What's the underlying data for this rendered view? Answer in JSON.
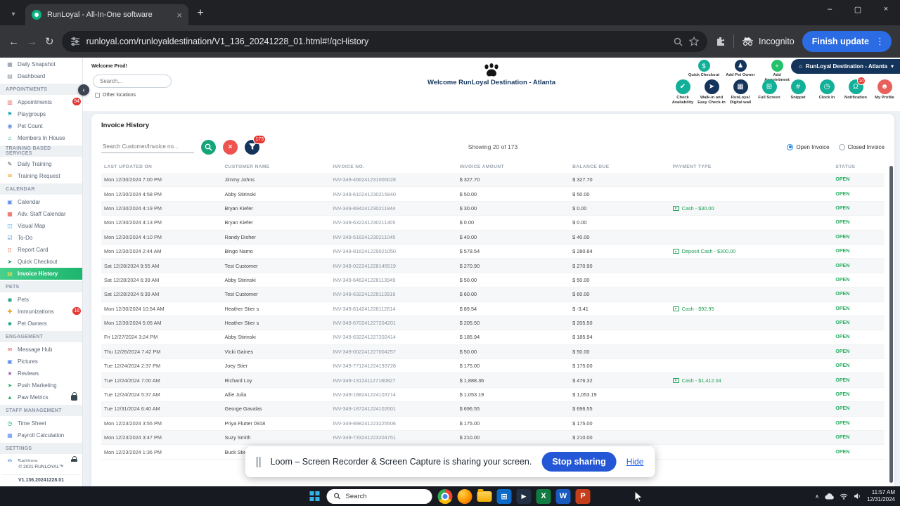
{
  "colors": {
    "teal": "#12b098",
    "navy": "#14345c",
    "badge_red": "#e53935",
    "status_green": "#27ae60",
    "link_blue": "#2563eb",
    "update_blue": "#2b6be4",
    "accent_green": "#1fb96b"
  },
  "browser": {
    "tab_title": "RunLoyal - All-In-One software",
    "url": "runloyal.com/runloyaldestination/V1_136_20241228_01.html#!/qcHistory",
    "incognito_label": "Incognito",
    "update_button": "Finish update"
  },
  "sidebar": {
    "top_items": [
      {
        "label": "Daily Snapshot",
        "icon": "snapshot-icon",
        "icon_color": "#7e8ca0"
      },
      {
        "label": "Dashboard",
        "icon": "dashboard-icon",
        "icon_color": "#8a94a6"
      }
    ],
    "sections": [
      {
        "title": "APPOINTMENTS",
        "items": [
          {
            "label": "Appointments",
            "icon": "appointments-icon",
            "icon_color": "#ef6461",
            "badge": "94"
          },
          {
            "label": "Playgroups",
            "icon": "playgroups-icon",
            "icon_color": "#17a2b8"
          },
          {
            "label": "Pet Count",
            "icon": "pet-count-icon",
            "icon_color": "#5b8def"
          },
          {
            "label": "Members In House",
            "icon": "members-icon",
            "icon_color": "#16a085"
          }
        ]
      },
      {
        "title": "TRAINING BASED SERVICES",
        "items": [
          {
            "label": "Daily Training",
            "icon": "daily-training-icon",
            "icon_color": "#444444"
          },
          {
            "label": "Training Request",
            "icon": "training-request-icon",
            "icon_color": "#f39c12"
          }
        ]
      },
      {
        "title": "CALENDAR",
        "items": [
          {
            "label": "Calendar",
            "icon": "calendar-icon",
            "icon_color": "#5b8def"
          },
          {
            "label": "Adv. Staff Calendar",
            "icon": "adv-calendar-icon",
            "icon_color": "#e74c3c"
          },
          {
            "label": "Visual Map",
            "icon": "visual-map-icon",
            "icon_color": "#48b0f7"
          },
          {
            "label": "To-Do",
            "icon": "todo-icon",
            "icon_color": "#3b7ddd"
          },
          {
            "label": "Report Card",
            "icon": "report-card-icon",
            "icon_color": "#e74c3c"
          },
          {
            "label": "Quick Checkout",
            "icon": "quick-checkout-icon",
            "icon_color": "#16a085"
          },
          {
            "label": "Invoice History",
            "icon": "invoice-history-icon",
            "icon_color": "#ffd54a",
            "active": true
          }
        ]
      },
      {
        "title": "PETS",
        "items": [
          {
            "label": "Pets",
            "icon": "pets-icon",
            "icon_color": "#16a085"
          },
          {
            "label": "Immunizations",
            "icon": "immunizations-icon",
            "icon_color": "#f39c12",
            "badge": "16"
          },
          {
            "label": "Pet Owners",
            "icon": "pet-owners-icon",
            "icon_color": "#16a085"
          }
        ]
      },
      {
        "title": "ENGAGEMENT",
        "items": [
          {
            "label": "Message Hub",
            "icon": "message-hub-icon",
            "icon_color": "#e8605c"
          },
          {
            "label": "Pictures",
            "icon": "pictures-icon",
            "icon_color": "#5b8def"
          },
          {
            "label": "Reviews",
            "icon": "reviews-icon",
            "icon_color": "#9b59b6"
          },
          {
            "label": "Push Marketing",
            "icon": "push-marketing-icon",
            "icon_color": "#27ae60"
          },
          {
            "label": "Paw Metrics",
            "icon": "paw-metrics-icon",
            "icon_color": "#27ae60",
            "locked": true
          }
        ]
      },
      {
        "title": "STAFF MANAGEMENT",
        "items": [
          {
            "label": "Time Sheet",
            "icon": "time-sheet-icon",
            "icon_color": "#16a085"
          },
          {
            "label": "Payroll Calculation",
            "icon": "payroll-icon",
            "icon_color": "#5b8def"
          }
        ]
      },
      {
        "title": "SETTINGS",
        "items": [
          {
            "label": "Settings",
            "icon": "settings-icon",
            "icon_color": "#3b7ddd",
            "locked": true
          }
        ]
      }
    ],
    "copyright": "© 2021  RUNLOYAL™",
    "version": "V1.136.20241228.01"
  },
  "header": {
    "welcome_label": "Welcome Prod!",
    "search_placeholder": "Search...",
    "other_locations_label": "Other locations",
    "welcome_title": "Welcome RunLoyal Destination - Atlanta",
    "location_label": "RunLoyal Destination - Atlanta",
    "quick_actions": [
      {
        "label": "Quick Checkout",
        "icon": "cart-icon",
        "color": "#12b098"
      },
      {
        "label": "Add Pet Owner",
        "icon": "person-add-icon",
        "color": "#14345c"
      },
      {
        "label": "Add Appointment",
        "icon": "calendar-add-icon",
        "color": "#23c16b"
      }
    ],
    "circle_icons": [
      {
        "label": "Check Availability",
        "icon": "availability-icon",
        "color": "#12b098"
      },
      {
        "label": "Walk-in and Easy Check-in",
        "icon": "walkin-icon",
        "color": "#14345c"
      },
      {
        "label": "RunLoyal Digital wall",
        "icon": "digital-wall-icon",
        "color": "#14345c"
      },
      {
        "label": "Full Screen",
        "icon": "fullscreen-icon",
        "color": "#12b098"
      },
      {
        "label": "Snippet",
        "icon": "snippet-icon",
        "color": "#12b098"
      },
      {
        "label": "Clock In",
        "icon": "clock-icon",
        "color": "#12b098"
      },
      {
        "label": "Notification",
        "icon": "bell-icon",
        "color": "#12b098",
        "badge": "10"
      },
      {
        "label": "My Profile",
        "icon": "profile-icon",
        "color": "#e8605c"
      }
    ]
  },
  "invoice": {
    "title": "Invoice History",
    "search_placeholder": "Search Customer/Invoice no...",
    "filter_count": "173",
    "showing": "Showing 20 of 173",
    "radio_open": "Open Invoice",
    "radio_closed": "Closed Invoice",
    "selected_filter": "Open Invoice",
    "table": {
      "columns": [
        "LAST UPDATED ON",
        "CUSTOMER NAME",
        "INVOICE NO.",
        "INVOICE AMOUNT",
        "BALANCE DUE",
        "PAYMENT TYPE",
        "STATUS"
      ],
      "rows": [
        {
          "updated": "Mon 12/30/2024 7:00 PM",
          "customer": "Jimmy Johns",
          "invoice": "INV-349-466241231000028",
          "amount": "$ 327.70",
          "balance": "$ 327.70",
          "payment": "",
          "status": "OPEN"
        },
        {
          "updated": "Mon 12/30/2024 4:58 PM",
          "customer": "Abby Stirinski",
          "invoice": "INV-349-610241230215840",
          "amount": "$ 50.00",
          "balance": "$ 50.00",
          "payment": "",
          "status": "OPEN"
        },
        {
          "updated": "Mon 12/30/2024 4:19 PM",
          "customer": "Bryan Kiefer",
          "invoice": "INV-349-894241230211844",
          "amount": "$ 30.00",
          "balance": "$ 0.00",
          "payment": "Cash - $30.00",
          "status": "OPEN"
        },
        {
          "updated": "Mon 12/30/2024 4:13 PM",
          "customer": "Bryan Kiefer",
          "invoice": "INV-349-632241230211305",
          "amount": "$ 0.00",
          "balance": "$ 0.00",
          "payment": "",
          "status": "OPEN"
        },
        {
          "updated": "Mon 12/30/2024 4:10 PM",
          "customer": "Randy Disher",
          "invoice": "INV-349-516241230211045",
          "amount": "$ 40.00",
          "balance": "$ 40.00",
          "payment": "",
          "status": "OPEN"
        },
        {
          "updated": "Mon 12/30/2024 2:44 AM",
          "customer": "Bingo Namo",
          "invoice": "INV-349-816241229021050",
          "amount": "$ 578.54",
          "balance": "$ 280.84",
          "payment": "Deposit Cash - $300.00",
          "status": "OPEN"
        },
        {
          "updated": "Sat 12/28/2024 9:55 AM",
          "customer": "Test Customer",
          "invoice": "INV-349-022241228145519",
          "amount": "$ 270.90",
          "balance": "$ 270.90",
          "payment": "",
          "status": "OPEN"
        },
        {
          "updated": "Sat 12/28/2024 6:39 AM",
          "customer": "Abby Stirinski",
          "invoice": "INV-349-646241228113949",
          "amount": "$ 50.00",
          "balance": "$ 50.00",
          "payment": "",
          "status": "OPEN"
        },
        {
          "updated": "Sat 12/28/2024 6:39 AM",
          "customer": "Test Customer",
          "invoice": "INV-349-632241228113916",
          "amount": "$ 60.00",
          "balance": "$ 60.00",
          "payment": "",
          "status": "OPEN"
        },
        {
          "updated": "Mon 12/30/2024 10:54 AM",
          "customer": "Heather Stier s",
          "invoice": "INV-349-614241228112614",
          "amount": "$ 89.54",
          "balance": "$ -3.41",
          "payment": "Cash - $92.95",
          "status": "OPEN"
        },
        {
          "updated": "Mon 12/30/2024 5:05 AM",
          "customer": "Heather Stier s",
          "invoice": "INV-349-670241227204201",
          "amount": "$ 205.50",
          "balance": "$ 205.50",
          "payment": "",
          "status": "OPEN"
        },
        {
          "updated": "Fri 12/27/2024 3:24 PM",
          "customer": "Abby Stirinski",
          "invoice": "INV-349-632241227202414",
          "amount": "$ 185.94",
          "balance": "$ 185.94",
          "payment": "",
          "status": "OPEN"
        },
        {
          "updated": "Thu 12/26/2024 7:42 PM",
          "customer": "Vicki Gaines",
          "invoice": "INV-349-002241227004257",
          "amount": "$ 50.00",
          "balance": "$ 50.00",
          "payment": "",
          "status": "OPEN"
        },
        {
          "updated": "Tue 12/24/2024 2:37 PM",
          "customer": "Joey Stier",
          "invoice": "INV-349-771241224193728",
          "amount": "$ 175.00",
          "balance": "$ 175.00",
          "payment": "",
          "status": "OPEN"
        },
        {
          "updated": "Tue 12/24/2024 7:00 AM",
          "customer": "Richard Loy",
          "invoice": "INV-349-131241127180827",
          "amount": "$ 1,888.36",
          "balance": "$ 476.32",
          "payment": "Cash - $1,412.04",
          "status": "OPEN"
        },
        {
          "updated": "Tue 12/24/2024 5:37 AM",
          "customer": "Allie Julia",
          "invoice": "INV-349-188241224103714",
          "amount": "$ 1,053.19",
          "balance": "$ 1,053.19",
          "payment": "",
          "status": "OPEN"
        },
        {
          "updated": "Tue 12/31/2024 6:40 AM",
          "customer": "George Gavalas",
          "invoice": "INV-349-187241224102601",
          "amount": "$ 696.55",
          "balance": "$ 696.55",
          "payment": "",
          "status": "OPEN"
        },
        {
          "updated": "Mon 12/23/2024 3:55 PM",
          "customer": "Priya Flutter 0918",
          "invoice": "INV-349-898241223225506",
          "amount": "$ 175.00",
          "balance": "$ 175.00",
          "payment": "",
          "status": "OPEN"
        },
        {
          "updated": "Mon 12/23/2024 3:47 PM",
          "customer": "Suzy Smith",
          "invoice": "INV-349-733241223204751",
          "amount": "$ 210.00",
          "balance": "$ 210.00",
          "payment": "",
          "status": "OPEN"
        },
        {
          "updated": "Mon 12/23/2024 1:36 PM",
          "customer": "Buck Stier",
          "invoice": "",
          "amount": "",
          "balance": "",
          "payment": "",
          "status": "OPEN"
        }
      ]
    }
  },
  "loom": {
    "message": "Loom – Screen Recorder & Screen Capture is sharing your screen.",
    "stop_label": "Stop sharing",
    "hide_label": "Hide"
  },
  "taskbar": {
    "search_label": "Search",
    "apps": [
      "chrome-icon",
      "firefox-icon",
      "file-explorer-icon",
      "store-icon",
      "media-player-icon",
      "excel-icon",
      "word-icon",
      "powerpoint-icon"
    ],
    "time": "11:57 AM",
    "date": "12/31/2024"
  }
}
